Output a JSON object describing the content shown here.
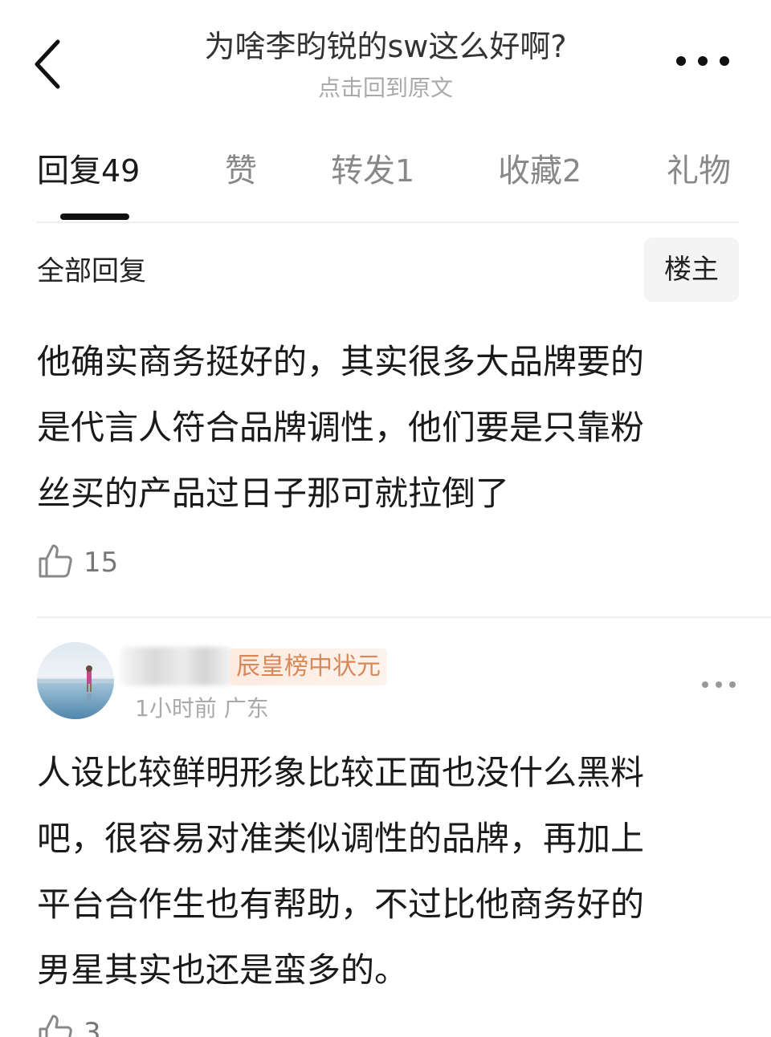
{
  "header": {
    "title": "为啥李昀锐的sw这么好啊?",
    "subtitle": "点击回到原文"
  },
  "tabs": [
    {
      "label": "回复",
      "count": "49"
    },
    {
      "label": "赞",
      "count": ""
    },
    {
      "label": "转发",
      "count": "1"
    },
    {
      "label": "收藏",
      "count": "2"
    },
    {
      "label": "礼物",
      "count": ""
    }
  ],
  "filter": {
    "label": "全部回复",
    "op_button": "楼主"
  },
  "comments": [
    {
      "lines": [
        "他确实商务挺好的，其实很多大品牌要的",
        "是代言人符合品牌调性，他们要是只靠粉",
        "丝买的产品过日子那可就拉倒了"
      ],
      "likes": "15"
    },
    {
      "badge": "辰皇榜中状元",
      "meta": "1小时前 广东",
      "lines": [
        "人设比较鲜明形象比较正面也没什么黑料",
        "吧，很容易对准类似调性的品牌，再加上",
        "平台合作生也有帮助，不过比他商务好的",
        "男星其实也还是蛮多的。"
      ],
      "likes": "3"
    }
  ],
  "icons": {
    "back": "chevron-left-icon",
    "more": "more-horizontal-icon",
    "like": "thumbs-up-icon"
  }
}
